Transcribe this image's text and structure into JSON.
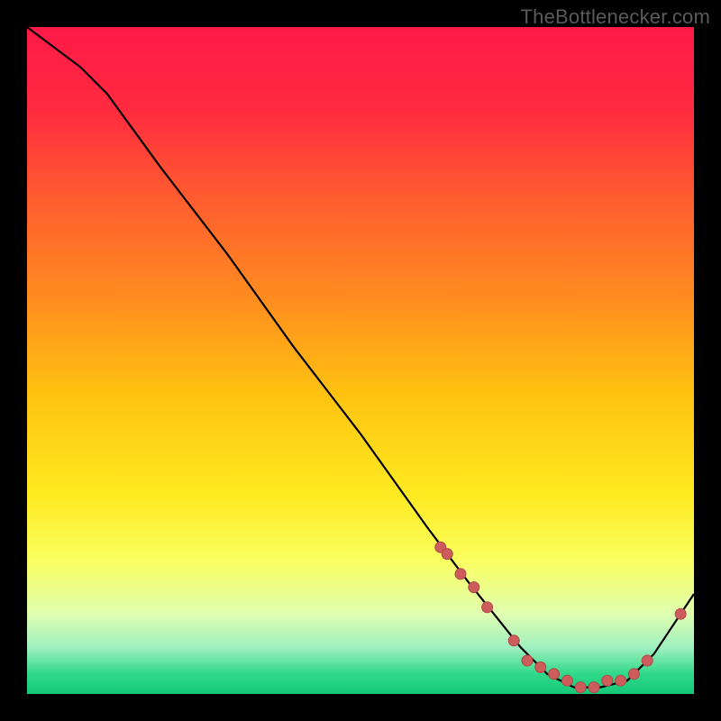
{
  "watermark": "TheBottlenecker.com",
  "chart_data": {
    "type": "line",
    "title": "",
    "xlabel": "",
    "ylabel": "",
    "xlim": [
      0,
      100
    ],
    "ylim": [
      0,
      100
    ],
    "grid": false,
    "series": [
      {
        "name": "curve",
        "x": [
          0,
          4,
          8,
          12,
          20,
          30,
          40,
          50,
          60,
          66,
          70,
          74,
          78,
          82,
          86,
          90,
          94,
          98,
          100
        ],
        "y": [
          100,
          97,
          94,
          90,
          79,
          66,
          52,
          39,
          25,
          17,
          12,
          7,
          3,
          1,
          1,
          2,
          6,
          12,
          15
        ]
      }
    ],
    "markers": {
      "name": "points",
      "x": [
        62,
        63,
        65,
        67,
        69,
        73,
        75,
        77,
        79,
        81,
        83,
        85,
        87,
        89,
        91,
        93,
        98
      ],
      "y": [
        22,
        21,
        18,
        16,
        13,
        8,
        5,
        4,
        3,
        2,
        1,
        1,
        2,
        2,
        3,
        5,
        12
      ]
    },
    "background_gradient": {
      "stops": [
        {
          "offset": 0.0,
          "color": "#ff1a48"
        },
        {
          "offset": 0.12,
          "color": "#ff2a40"
        },
        {
          "offset": 0.25,
          "color": "#ff5a30"
        },
        {
          "offset": 0.4,
          "color": "#ff8a20"
        },
        {
          "offset": 0.55,
          "color": "#ffc210"
        },
        {
          "offset": 0.7,
          "color": "#ffea20"
        },
        {
          "offset": 0.8,
          "color": "#faff60"
        },
        {
          "offset": 0.88,
          "color": "#e0ffb0"
        },
        {
          "offset": 0.93,
          "color": "#a0f0c0"
        },
        {
          "offset": 0.97,
          "color": "#30d989"
        },
        {
          "offset": 1.0,
          "color": "#14c878"
        }
      ]
    },
    "colors": {
      "line": "#000000",
      "marker_fill": "#cd5c5c",
      "marker_stroke": "#b04848"
    }
  }
}
